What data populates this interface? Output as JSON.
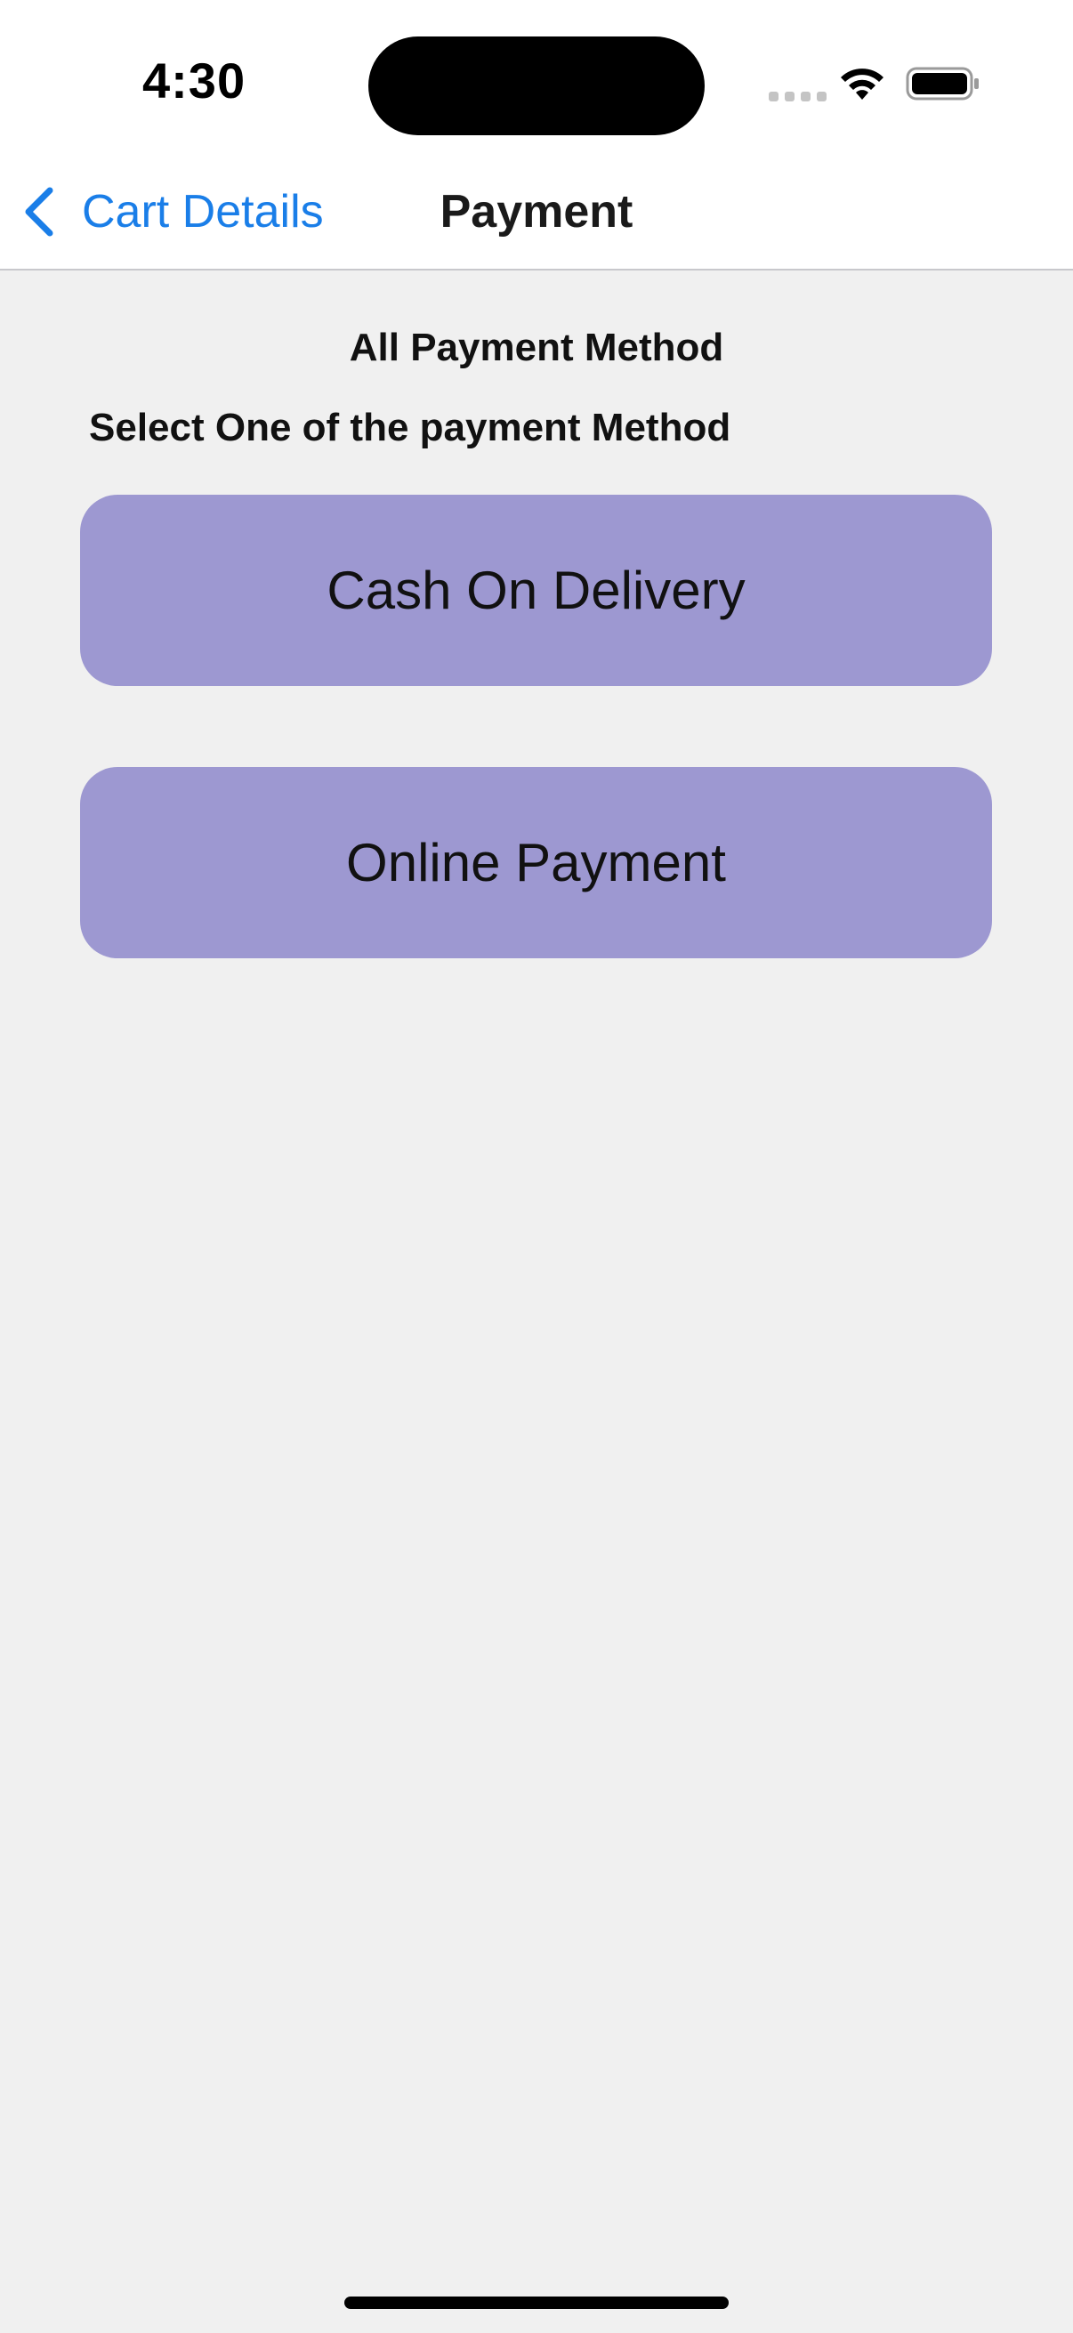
{
  "status_bar": {
    "time": "4:30",
    "icons": [
      "cellular-signal-icon",
      "wifi-icon",
      "battery-icon"
    ]
  },
  "nav": {
    "back_label": "Cart Details",
    "title": "Payment",
    "accent_color": "#1a7ee8"
  },
  "main": {
    "heading": "All Payment Method",
    "subheading": "Select One of the payment Method",
    "options": [
      {
        "label": "Cash On Delivery"
      },
      {
        "label": "Online Payment"
      }
    ],
    "button_color": "#9d98d1",
    "background_color": "#f0f0f0"
  }
}
